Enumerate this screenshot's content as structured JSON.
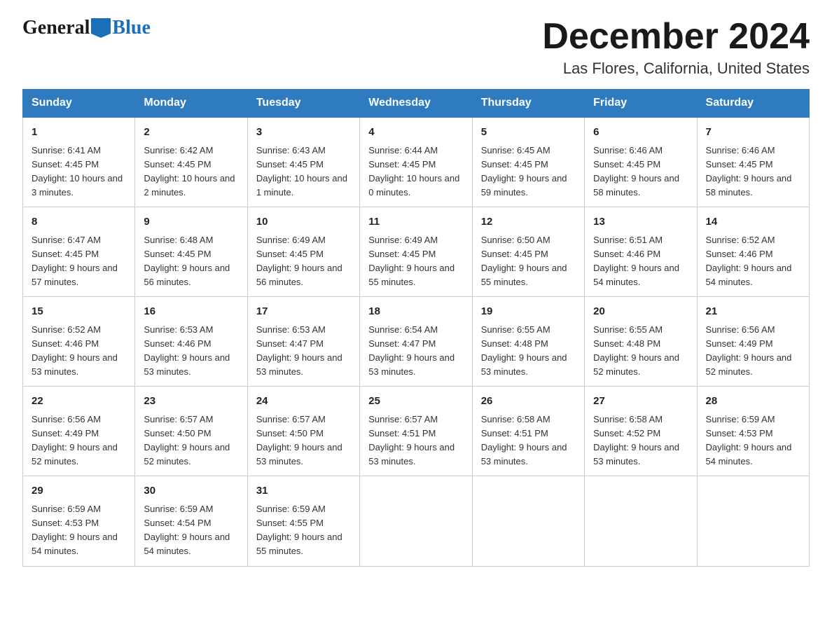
{
  "logo": {
    "general_text": "General",
    "blue_text": "Blue"
  },
  "header": {
    "month_year": "December 2024",
    "location": "Las Flores, California, United States"
  },
  "days_of_week": [
    "Sunday",
    "Monday",
    "Tuesday",
    "Wednesday",
    "Thursday",
    "Friday",
    "Saturday"
  ],
  "weeks": [
    [
      {
        "num": "1",
        "sunrise": "6:41 AM",
        "sunset": "4:45 PM",
        "daylight": "10 hours and 3 minutes."
      },
      {
        "num": "2",
        "sunrise": "6:42 AM",
        "sunset": "4:45 PM",
        "daylight": "10 hours and 2 minutes."
      },
      {
        "num": "3",
        "sunrise": "6:43 AM",
        "sunset": "4:45 PM",
        "daylight": "10 hours and 1 minute."
      },
      {
        "num": "4",
        "sunrise": "6:44 AM",
        "sunset": "4:45 PM",
        "daylight": "10 hours and 0 minutes."
      },
      {
        "num": "5",
        "sunrise": "6:45 AM",
        "sunset": "4:45 PM",
        "daylight": "9 hours and 59 minutes."
      },
      {
        "num": "6",
        "sunrise": "6:46 AM",
        "sunset": "4:45 PM",
        "daylight": "9 hours and 58 minutes."
      },
      {
        "num": "7",
        "sunrise": "6:46 AM",
        "sunset": "4:45 PM",
        "daylight": "9 hours and 58 minutes."
      }
    ],
    [
      {
        "num": "8",
        "sunrise": "6:47 AM",
        "sunset": "4:45 PM",
        "daylight": "9 hours and 57 minutes."
      },
      {
        "num": "9",
        "sunrise": "6:48 AM",
        "sunset": "4:45 PM",
        "daylight": "9 hours and 56 minutes."
      },
      {
        "num": "10",
        "sunrise": "6:49 AM",
        "sunset": "4:45 PM",
        "daylight": "9 hours and 56 minutes."
      },
      {
        "num": "11",
        "sunrise": "6:49 AM",
        "sunset": "4:45 PM",
        "daylight": "9 hours and 55 minutes."
      },
      {
        "num": "12",
        "sunrise": "6:50 AM",
        "sunset": "4:45 PM",
        "daylight": "9 hours and 55 minutes."
      },
      {
        "num": "13",
        "sunrise": "6:51 AM",
        "sunset": "4:46 PM",
        "daylight": "9 hours and 54 minutes."
      },
      {
        "num": "14",
        "sunrise": "6:52 AM",
        "sunset": "4:46 PM",
        "daylight": "9 hours and 54 minutes."
      }
    ],
    [
      {
        "num": "15",
        "sunrise": "6:52 AM",
        "sunset": "4:46 PM",
        "daylight": "9 hours and 53 minutes."
      },
      {
        "num": "16",
        "sunrise": "6:53 AM",
        "sunset": "4:46 PM",
        "daylight": "9 hours and 53 minutes."
      },
      {
        "num": "17",
        "sunrise": "6:53 AM",
        "sunset": "4:47 PM",
        "daylight": "9 hours and 53 minutes."
      },
      {
        "num": "18",
        "sunrise": "6:54 AM",
        "sunset": "4:47 PM",
        "daylight": "9 hours and 53 minutes."
      },
      {
        "num": "19",
        "sunrise": "6:55 AM",
        "sunset": "4:48 PM",
        "daylight": "9 hours and 53 minutes."
      },
      {
        "num": "20",
        "sunrise": "6:55 AM",
        "sunset": "4:48 PM",
        "daylight": "9 hours and 52 minutes."
      },
      {
        "num": "21",
        "sunrise": "6:56 AM",
        "sunset": "4:49 PM",
        "daylight": "9 hours and 52 minutes."
      }
    ],
    [
      {
        "num": "22",
        "sunrise": "6:56 AM",
        "sunset": "4:49 PM",
        "daylight": "9 hours and 52 minutes."
      },
      {
        "num": "23",
        "sunrise": "6:57 AM",
        "sunset": "4:50 PM",
        "daylight": "9 hours and 52 minutes."
      },
      {
        "num": "24",
        "sunrise": "6:57 AM",
        "sunset": "4:50 PM",
        "daylight": "9 hours and 53 minutes."
      },
      {
        "num": "25",
        "sunrise": "6:57 AM",
        "sunset": "4:51 PM",
        "daylight": "9 hours and 53 minutes."
      },
      {
        "num": "26",
        "sunrise": "6:58 AM",
        "sunset": "4:51 PM",
        "daylight": "9 hours and 53 minutes."
      },
      {
        "num": "27",
        "sunrise": "6:58 AM",
        "sunset": "4:52 PM",
        "daylight": "9 hours and 53 minutes."
      },
      {
        "num": "28",
        "sunrise": "6:59 AM",
        "sunset": "4:53 PM",
        "daylight": "9 hours and 54 minutes."
      }
    ],
    [
      {
        "num": "29",
        "sunrise": "6:59 AM",
        "sunset": "4:53 PM",
        "daylight": "9 hours and 54 minutes."
      },
      {
        "num": "30",
        "sunrise": "6:59 AM",
        "sunset": "4:54 PM",
        "daylight": "9 hours and 54 minutes."
      },
      {
        "num": "31",
        "sunrise": "6:59 AM",
        "sunset": "4:55 PM",
        "daylight": "9 hours and 55 minutes."
      },
      null,
      null,
      null,
      null
    ]
  ]
}
